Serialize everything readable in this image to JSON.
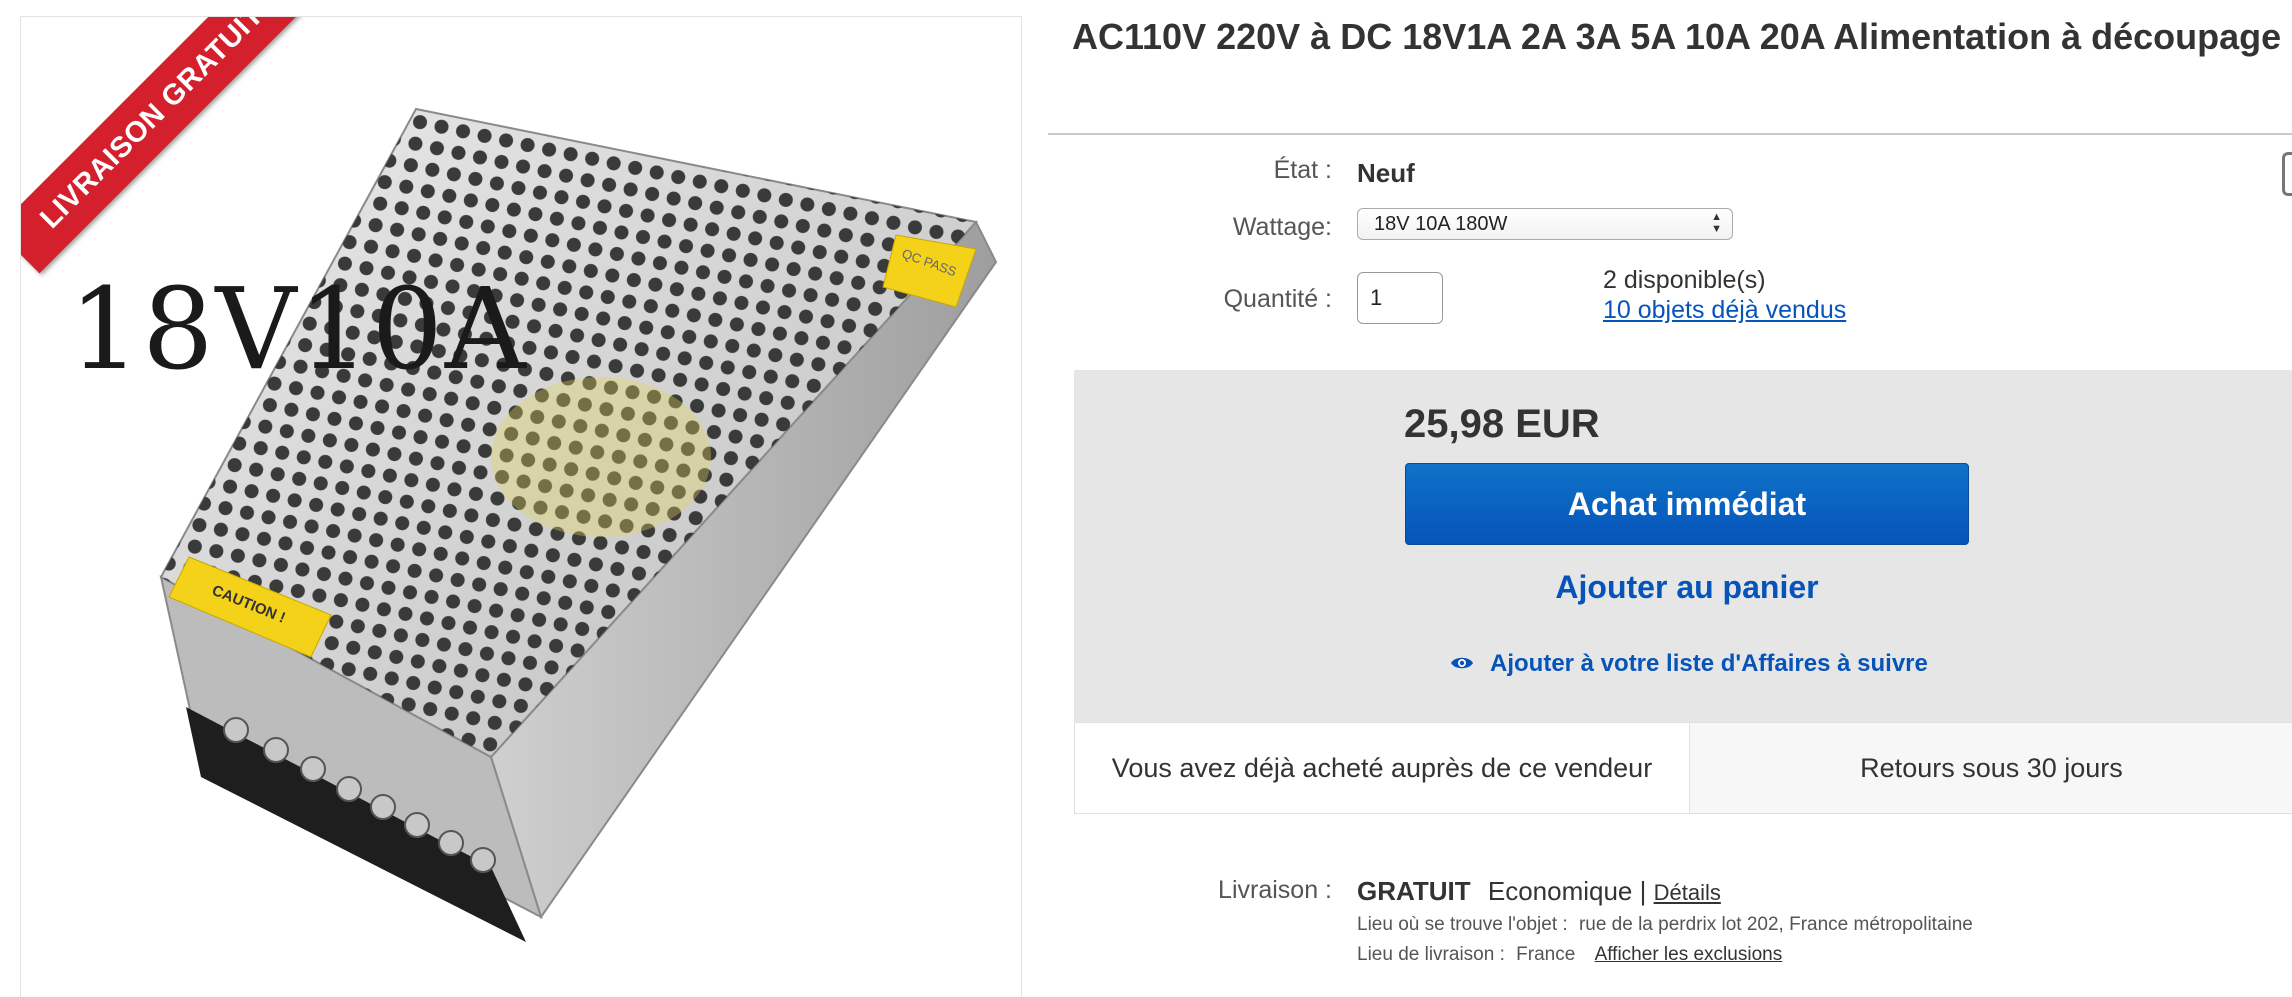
{
  "product_image": {
    "ribbon_text": "LIVRAISON GRATUITE",
    "label": "18V10A",
    "sticker_caution": "CAUTION !",
    "sticker_qc": "QC  PASS"
  },
  "listing": {
    "title": "AC110V 220V à DC 18V1A 2A 3A 5A 10A 20A Alimentation à découpage",
    "condition_label": "État :",
    "condition_value": "Neuf",
    "wattage_label": "Wattage:",
    "wattage_selected": "18V 10A 180W",
    "quantity_label": "Quantité :",
    "quantity_value": "1",
    "available_text": "2 disponible(s)",
    "sold_link": "10 objets déjà vendus"
  },
  "buy_box": {
    "price": "25,98 EUR",
    "buy_now": "Achat immédiat",
    "add_to_cart": "Ajouter au panier",
    "watchlist": "Ajouter à votre liste d'Affaires à suivre"
  },
  "info": {
    "previous_purchase": "Vous avez déjà acheté auprès de ce vendeur",
    "returns": "Retours sous 30 jours"
  },
  "shipping": {
    "label": "Livraison :",
    "free": "GRATUIT",
    "method": "Economique |",
    "details_link": "Détails",
    "location_label": "Lieu où se trouve l'objet :",
    "location_value": "rue de la perdrix lot 202, France métropolitaine",
    "delivery_label": "Lieu de livraison :",
    "delivery_value": "France",
    "exclusions_link": "Afficher les exclusions"
  },
  "colors": {
    "link_blue": "#0654ba",
    "buy_button": "#0654ba",
    "ribbon_red": "#d4202c",
    "buy_box_bg": "#e6e6e6"
  },
  "icons": [
    "eye-icon",
    "select-arrows-icon"
  ]
}
